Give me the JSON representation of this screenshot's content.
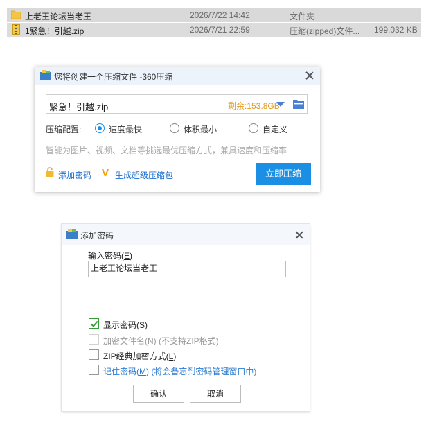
{
  "file_list": {
    "rows": [
      {
        "name": "上老王论坛当老王",
        "date": "2026/7/22 14:42",
        "type": "文件夹",
        "size": "",
        "icon": "folder-icon"
      },
      {
        "name": "1緊急！引越.zip",
        "date": "2026/7/21 22:59",
        "type": "压缩(zipped)文件...",
        "size": "199,032 KB",
        "icon": "zip-file-icon"
      }
    ]
  },
  "compress_dialog": {
    "title": "您将创建一个压缩文件 -360压缩",
    "filename": "緊急！引越.zip",
    "remaining": "剩余:153.8GB",
    "config_label": "压缩配置:",
    "options": [
      "速度最快",
      "体积最小",
      "自定义"
    ],
    "selected_option": "速度最快",
    "hint": "智能为图片、视频、文档等挑选最优压缩方式，兼具速度和压缩率",
    "add_password_label": "添加密码",
    "super_pack_label": "生成超级压缩包",
    "compress_button": "立即压缩",
    "accent_color": "#1a8fe3"
  },
  "password_dialog": {
    "title": "添加密码",
    "input_label": "输入密码(",
    "input_label_key": "E",
    "input_label_end": ")",
    "password_value": "上老王论坛当老王",
    "show_password": {
      "label": "显示密码(",
      "key": "S",
      "end": ")",
      "checked": true
    },
    "encrypt_filenames": {
      "label": "加密文件名(",
      "key": "N",
      "end": ") (不支持ZIP格式)",
      "checked": false,
      "disabled": true
    },
    "zip_classic": {
      "label": "ZIP经典加密方式(",
      "key": "L",
      "end": ")",
      "checked": false
    },
    "remember": {
      "label": "记住密码(",
      "key": "M",
      "end": ") (将会备忘到密码管理窗口中)",
      "checked": false
    },
    "ok_button": "确认",
    "cancel_button": "取消"
  }
}
